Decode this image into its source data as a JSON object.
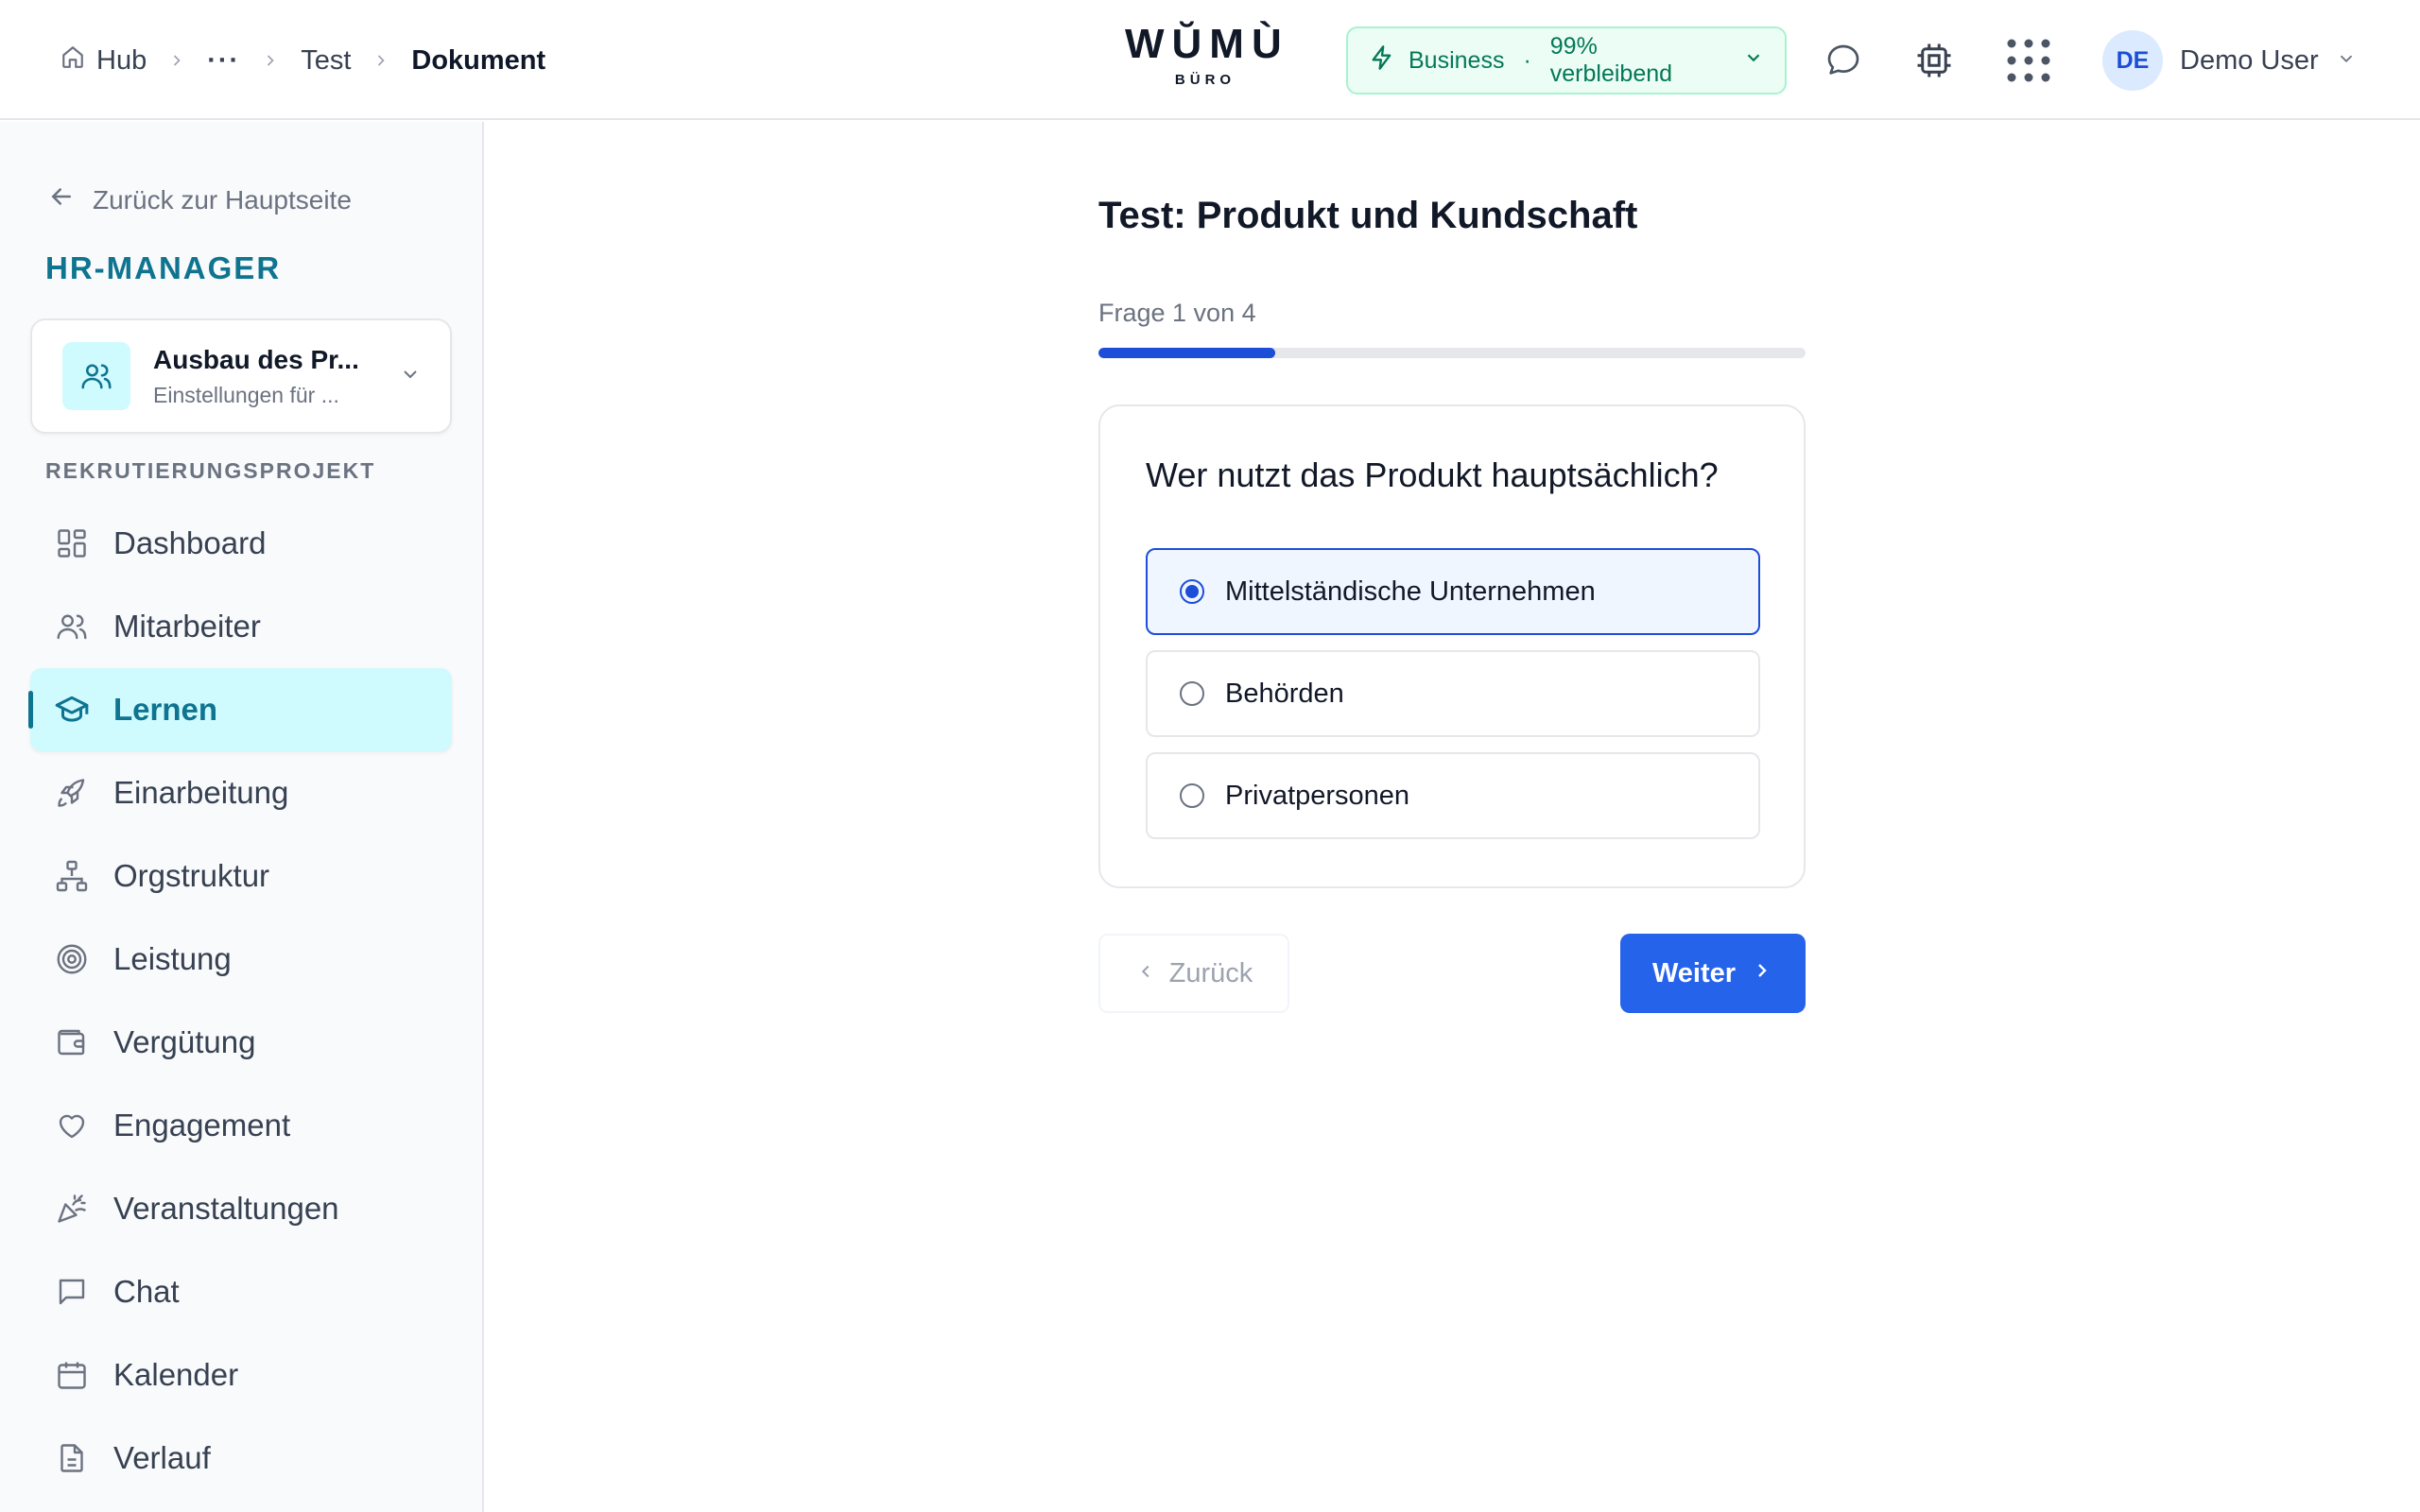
{
  "breadcrumb": {
    "items": [
      {
        "label": "Hub",
        "icon": "home-icon"
      },
      {
        "label": "···"
      },
      {
        "label": "Test"
      },
      {
        "label": "Dokument"
      }
    ]
  },
  "logo": {
    "main": "WŬMÙ",
    "sub": "BÜRO"
  },
  "plan": {
    "name": "Business",
    "separator": "·",
    "remaining": "99% verbleibend",
    "color": "#047857"
  },
  "header_icons": [
    "chat-bubble-icon",
    "chip-icon",
    "apps-grid-icon"
  ],
  "user": {
    "initials": "DE",
    "name": "Demo User"
  },
  "sidebar": {
    "back_label": "Zurück zur Hauptseite",
    "app_title": "HR-MANAGER",
    "project": {
      "title": "Ausbau des Pr...",
      "subtitle": "Einstellungen für ..."
    },
    "section_label": "REKRUTIERUNGSPROJEKT",
    "items": [
      {
        "label": "Dashboard",
        "icon": "dashboard-icon",
        "active": false
      },
      {
        "label": "Mitarbeiter",
        "icon": "users-icon",
        "active": false
      },
      {
        "label": "Lernen",
        "icon": "graduation-cap-icon",
        "active": true
      },
      {
        "label": "Einarbeitung",
        "icon": "rocket-icon",
        "active": false
      },
      {
        "label": "Orgstruktur",
        "icon": "org-chart-icon",
        "active": false
      },
      {
        "label": "Leistung",
        "icon": "target-icon",
        "active": false
      },
      {
        "label": "Vergütung",
        "icon": "wallet-icon",
        "active": false
      },
      {
        "label": "Engagement",
        "icon": "heart-icon",
        "active": false
      },
      {
        "label": "Veranstaltungen",
        "icon": "party-popper-icon",
        "active": false
      },
      {
        "label": "Chat",
        "icon": "chat-icon",
        "active": false
      },
      {
        "label": "Kalender",
        "icon": "calendar-icon",
        "active": false
      },
      {
        "label": "Verlauf",
        "icon": "document-icon",
        "active": false
      }
    ]
  },
  "quiz": {
    "title": "Test: Produkt und Kundschaft",
    "progress_label": "Frage 1 von 4",
    "progress": 0.25,
    "question": "Wer nutzt das Produkt hauptsächlich?",
    "options": [
      {
        "label": "Mittelständische Unternehmen",
        "selected": true
      },
      {
        "label": "Behörden",
        "selected": false
      },
      {
        "label": "Privatpersonen",
        "selected": false
      }
    ],
    "back_label": "Zurück",
    "next_label": "Weiter"
  },
  "colors": {
    "accent": "#2563eb",
    "teal": "#0e7490",
    "active_bg": "#cffafe"
  }
}
